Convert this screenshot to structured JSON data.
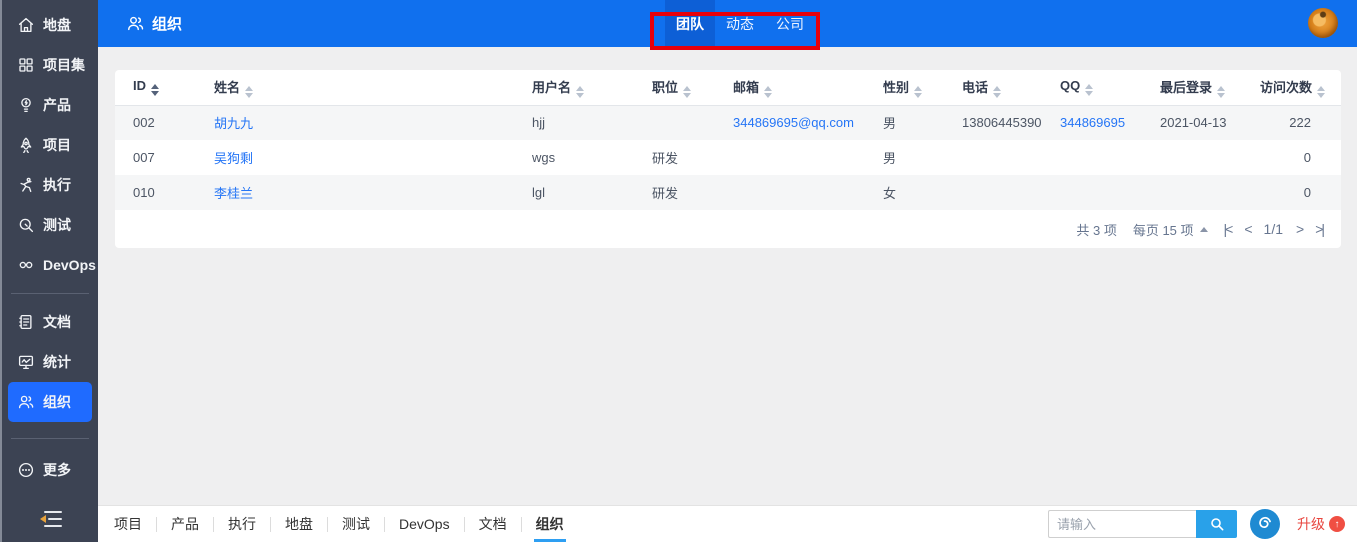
{
  "app": {
    "header_blue": "#1070ee",
    "sidebar_bg": "#3c4353",
    "active_item_blue": "#1f6bff",
    "link_blue": "#2575f6",
    "annotation_red": "#e8000b",
    "search_btn_blue": "#29a1e9",
    "upgrade_red": "#e8463f"
  },
  "sidebar": {
    "items": [
      {
        "label": "地盘",
        "icon": "home-icon"
      },
      {
        "label": "项目集",
        "icon": "program-grid-icon"
      },
      {
        "label": "产品",
        "icon": "product-bulb-icon"
      },
      {
        "label": "项目",
        "icon": "project-rocket-icon"
      },
      {
        "label": "执行",
        "icon": "execution-runner-icon"
      },
      {
        "label": "测试",
        "icon": "test-magnifier-icon"
      },
      {
        "label": "DevOps",
        "icon": "devops-infinity-icon"
      },
      {
        "label": "文档",
        "icon": "doc-icon"
      },
      {
        "label": "统计",
        "icon": "stats-monitor-icon"
      },
      {
        "label": "组织",
        "icon": "org-users-icon"
      },
      {
        "label": "更多",
        "icon": "more-ellipsis-icon"
      }
    ]
  },
  "header": {
    "title": "组织",
    "tabs": [
      {
        "label": "团队",
        "active": true
      },
      {
        "label": "动态",
        "active": false
      },
      {
        "label": "公司",
        "active": false
      }
    ]
  },
  "table": {
    "columns": [
      "ID",
      "姓名",
      "用户名",
      "职位",
      "邮箱",
      "性别",
      "电话",
      "QQ",
      "最后登录",
      "访问次数"
    ],
    "rows": [
      {
        "id": "002",
        "name": "胡九九",
        "username": "hjj",
        "position": "",
        "email": "344869695@qq.com",
        "gender": "男",
        "phone": "13806445390",
        "qq": "344869695",
        "last_login": "2021-04-13",
        "visits": "222"
      },
      {
        "id": "007",
        "name": "吴狗剩",
        "username": "wgs",
        "position": "研发",
        "email": "",
        "gender": "男",
        "phone": "",
        "qq": "",
        "last_login": "",
        "visits": "0"
      },
      {
        "id": "010",
        "name": "李桂兰",
        "username": "lgl",
        "position": "研发",
        "email": "",
        "gender": "女",
        "phone": "",
        "qq": "",
        "last_login": "",
        "visits": "0"
      }
    ]
  },
  "pagination": {
    "total": "共 3 项",
    "per_page": "每页 15 项",
    "page": "1/1",
    "first_icon": "|<",
    "prev_icon": "<",
    "next_icon": ">",
    "last_icon": ">|"
  },
  "bottom": {
    "tabs": [
      "项目",
      "产品",
      "执行",
      "地盘",
      "测试",
      "DevOps",
      "文档",
      "组织"
    ],
    "active_tab": "组织",
    "search_placeholder": "请输入",
    "upgrade_label": "升级",
    "upgrade_badge": "↑"
  }
}
